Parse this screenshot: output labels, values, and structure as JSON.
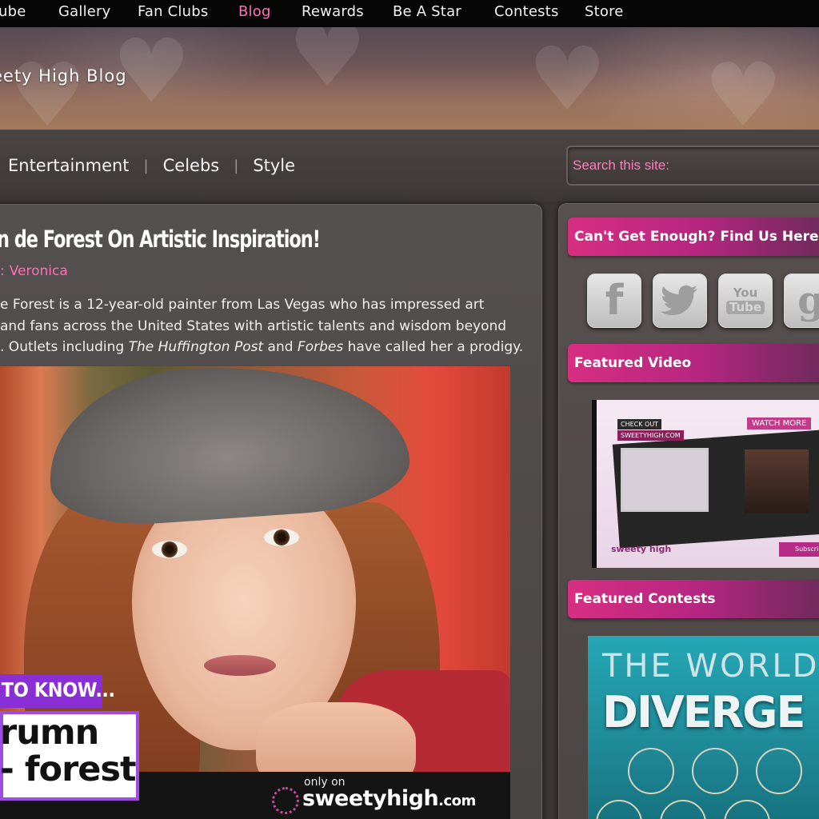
{
  "topnav": {
    "items": [
      {
        "label": "ube"
      },
      {
        "label": "Gallery"
      },
      {
        "label": "Fan Clubs"
      },
      {
        "label": "Blog",
        "active": true
      },
      {
        "label": "Rewards"
      },
      {
        "label": "Be A Star"
      },
      {
        "label": "Contests"
      },
      {
        "label": "Store"
      }
    ]
  },
  "banner": {
    "title": "eety High Blog"
  },
  "subnav": {
    "items": [
      {
        "label": "Entertainment"
      },
      {
        "label": "Celebs"
      },
      {
        "label": "Style"
      }
    ],
    "separator": "|"
  },
  "search": {
    "placeholder": "Search this site:"
  },
  "article": {
    "title": "n de Forest On Artistic Inspiration!",
    "byline_prefix": ":",
    "author": "Veronica",
    "intro": {
      "line1": "e Forest is a 12-year-old painter from Las Vegas who has impressed art",
      "line2": "and fans across the United States with artistic talents and wisdom beyond",
      "line3_a": ". Outlets including ",
      "line3_em1": "The Huffington Post",
      "line3_b": " and ",
      "line3_em2": "Forbes",
      "line3_c": " have called her a prodigy."
    },
    "image_overlay": {
      "tag": "TO KNOW...",
      "name_line1": "rumn",
      "name_line2": "- forest",
      "only_on": "only on",
      "watermark": "sweetyhigh",
      "watermark_tld": ".com"
    }
  },
  "sidebar": {
    "find_us": "Can't Get Enough? Find Us Here!",
    "social": [
      {
        "name": "facebook",
        "glyph": "f"
      },
      {
        "name": "twitter",
        "glyph": "🐦"
      },
      {
        "name": "youtube",
        "glyph_top": "You",
        "glyph_bottom": "Tube"
      },
      {
        "name": "google-plus",
        "glyph": "g"
      }
    ],
    "featured_video": "Featured Video",
    "video": {
      "label1": "CHECK OUT",
      "label2": "SWEETYHIGH.COM",
      "watch": "WATCH MORE",
      "brand": "sweety high",
      "subscribe": "Subscribe"
    },
    "featured_contests": "Featured Contests",
    "contest": {
      "line1": "THE WORLD",
      "line2": "DIVERGE"
    }
  },
  "colors": {
    "accent_pink": "#ff6fb5",
    "header_gradient_start": "#d72e82",
    "nav_bg": "#050505"
  }
}
